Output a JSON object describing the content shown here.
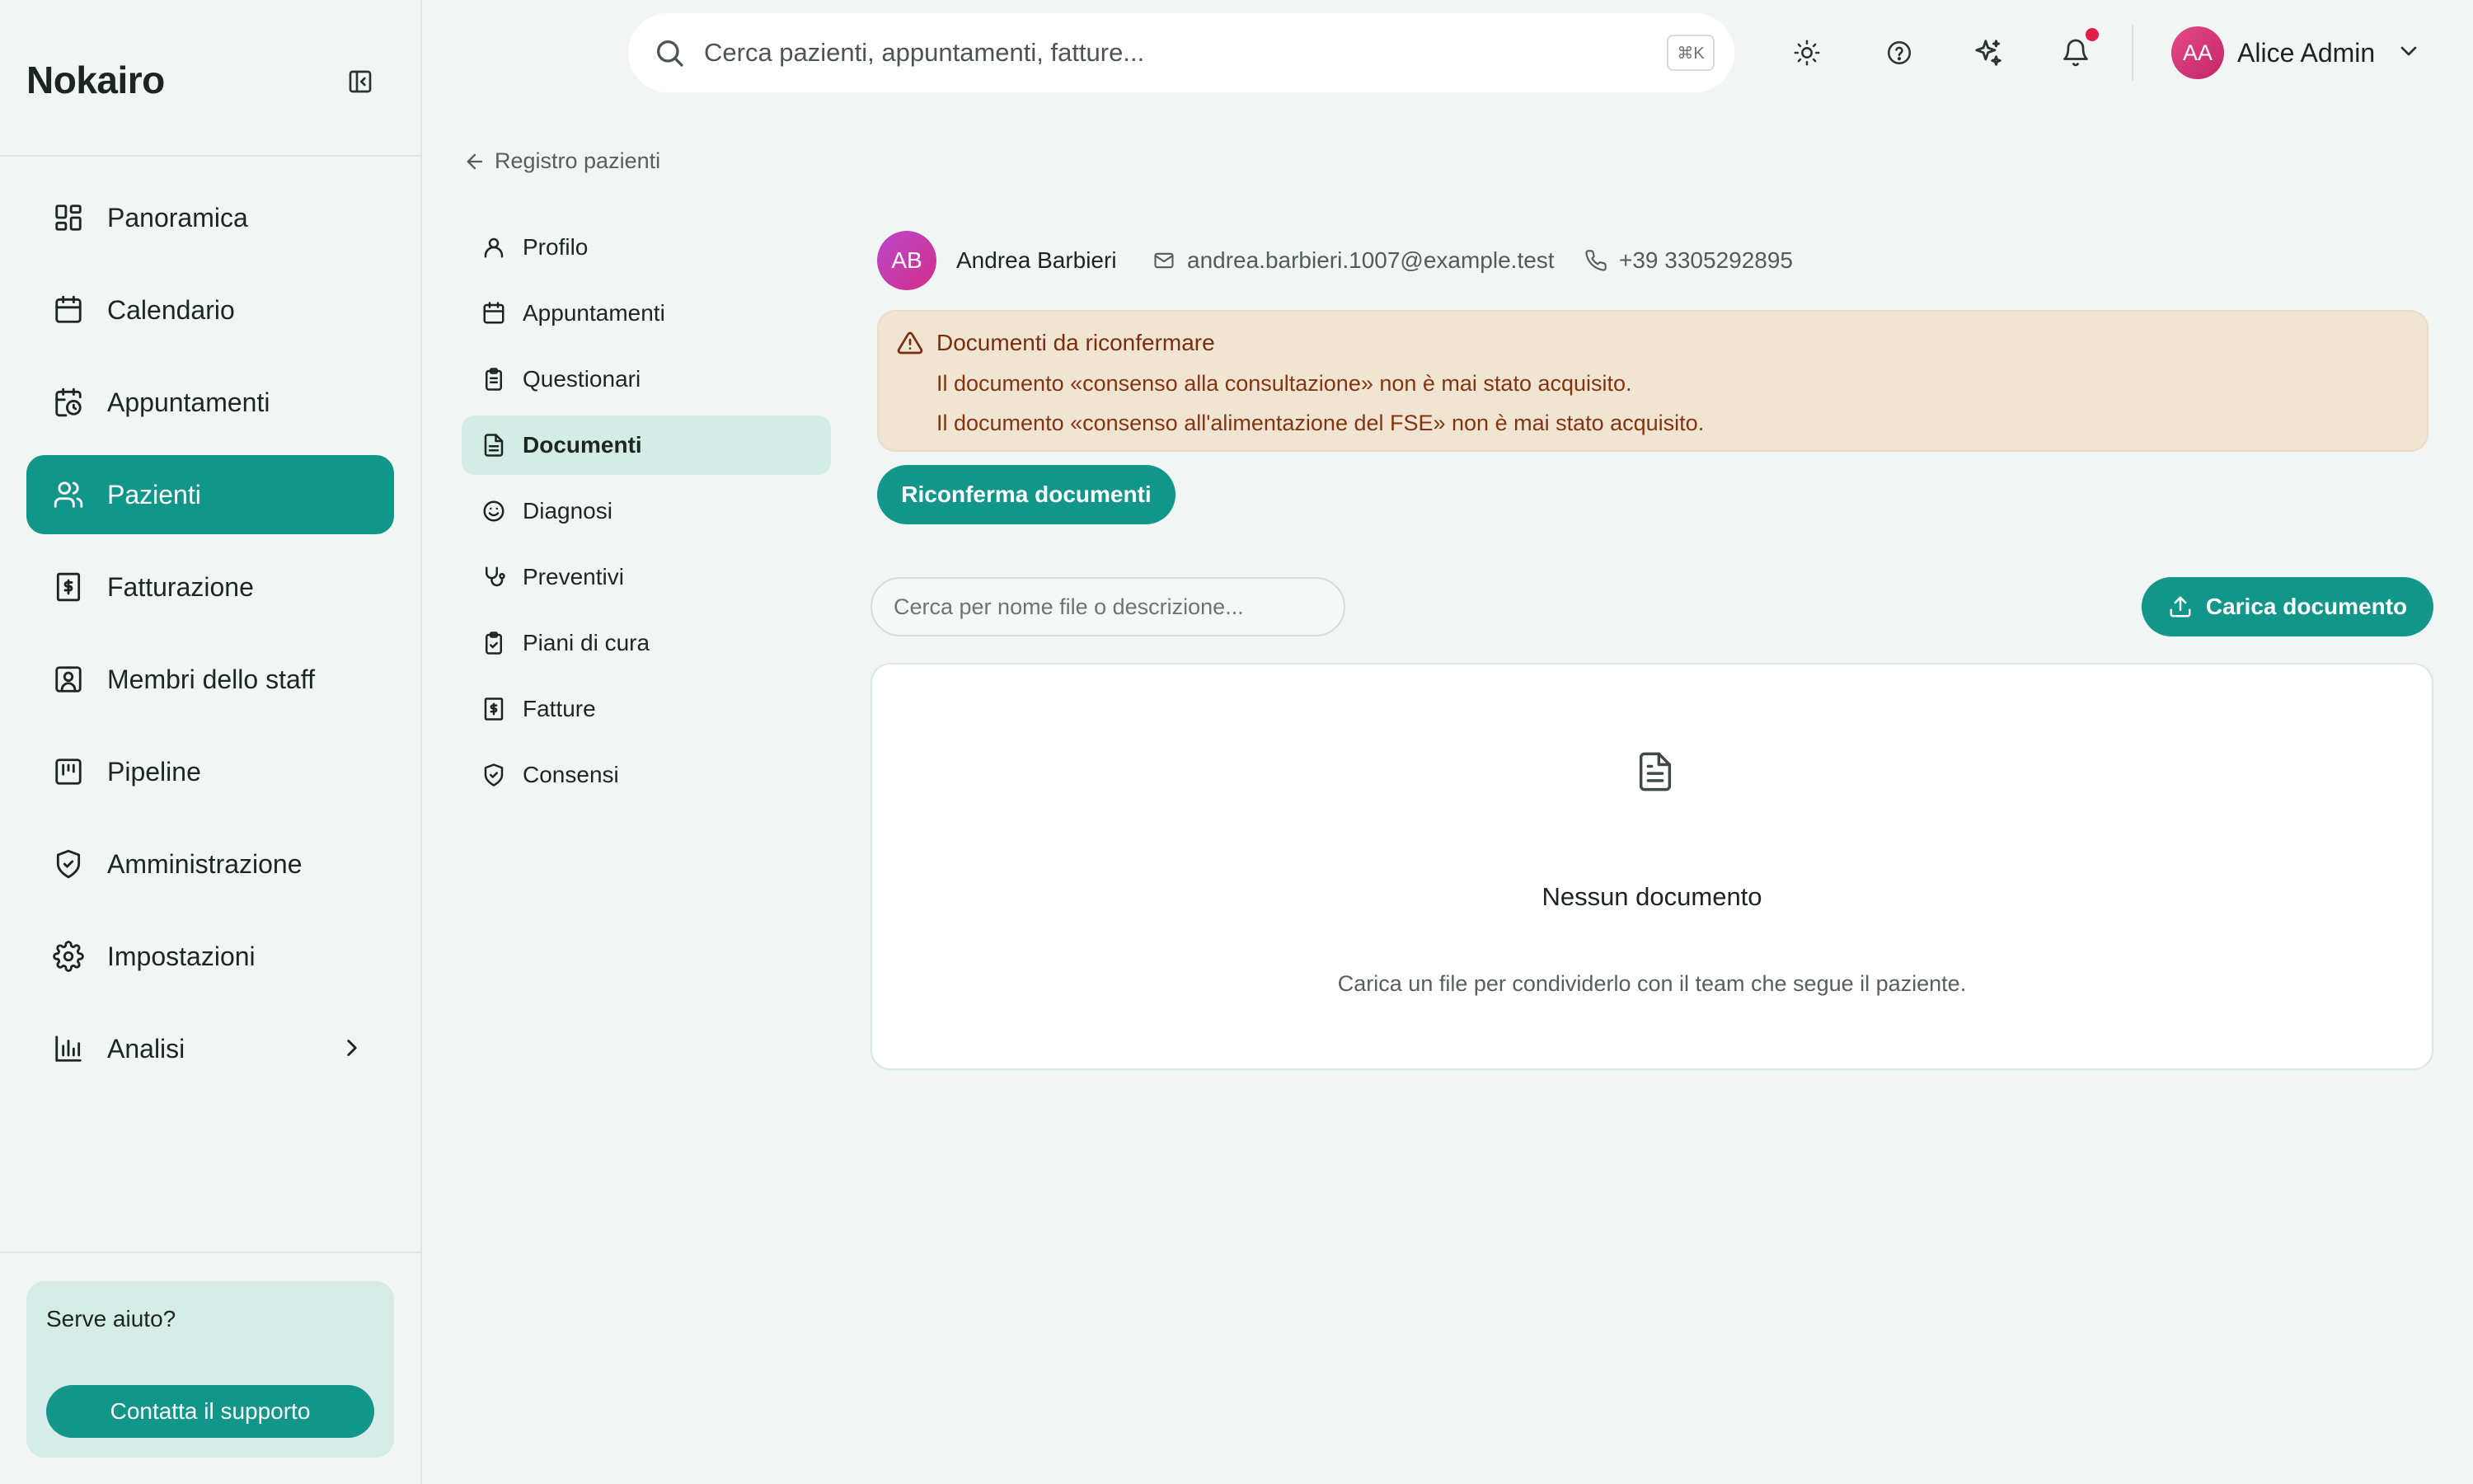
{
  "app": {
    "brand": "Nokairo"
  },
  "sidebar": {
    "items": [
      {
        "label": "Panoramica",
        "icon": "dashboard-icon",
        "active": false
      },
      {
        "label": "Calendario",
        "icon": "calendar-icon",
        "active": false
      },
      {
        "label": "Appuntamenti",
        "icon": "calendar-clock-icon",
        "active": false
      },
      {
        "label": "Pazienti",
        "icon": "users-icon",
        "active": true
      },
      {
        "label": "Fatturazione",
        "icon": "receipt-icon",
        "active": false
      },
      {
        "label": "Membri dello staff",
        "icon": "id-badge-icon",
        "active": false
      },
      {
        "label": "Pipeline",
        "icon": "kanban-icon",
        "active": false
      },
      {
        "label": "Amministrazione",
        "icon": "shield-check-icon",
        "active": false
      },
      {
        "label": "Impostazioni",
        "icon": "gear-icon",
        "active": false
      },
      {
        "label": "Analisi",
        "icon": "bar-chart-icon",
        "active": false
      }
    ],
    "help": {
      "title": "Serve aiuto?",
      "button": "Contatta il supporto"
    }
  },
  "topbar": {
    "search_placeholder": "Cerca pazienti, appuntamenti, fatture...",
    "shortcut": "⌘K",
    "user": {
      "initials": "AA",
      "name": "Alice Admin"
    }
  },
  "breadcrumb": {
    "back_label": "Registro pazienti"
  },
  "subnav": {
    "items": [
      {
        "label": "Profilo",
        "icon": "user-icon"
      },
      {
        "label": "Appuntamenti",
        "icon": "calendar-icon"
      },
      {
        "label": "Questionari",
        "icon": "clipboard-list-icon"
      },
      {
        "label": "Documenti",
        "icon": "file-text-icon"
      },
      {
        "label": "Diagnosi",
        "icon": "smile-icon"
      },
      {
        "label": "Preventivi",
        "icon": "stethoscope-icon"
      },
      {
        "label": "Piani di cura",
        "icon": "clipboard-check-icon"
      },
      {
        "label": "Fatture",
        "icon": "receipt-icon"
      },
      {
        "label": "Consensi",
        "icon": "shield-check-icon"
      }
    ],
    "active": "Documenti"
  },
  "patient": {
    "initials": "AB",
    "name": "Andrea Barbieri",
    "email": "andrea.barbieri.1007@example.test",
    "phone": "+39 3305292895"
  },
  "warning": {
    "title": "Documenti da riconfermare",
    "line1": "Il documento «consenso alla consultazione» non è mai stato acquisito.",
    "line2": "Il documento «consenso all'alimentazione del FSE» non è mai stato acquisito.",
    "button": "Riconferma documenti"
  },
  "documents": {
    "search_placeholder": "Cerca per nome file o descrizione...",
    "upload_button": "Carica documento",
    "empty_title": "Nessun documento",
    "empty_desc": "Carica un file per condividerlo con il team che segue il paziente."
  },
  "colors": {
    "accent": "#13968a",
    "warning_bg": "#f0e4d3",
    "warning_text": "#7a2e0b",
    "notification": "#e11d48"
  }
}
